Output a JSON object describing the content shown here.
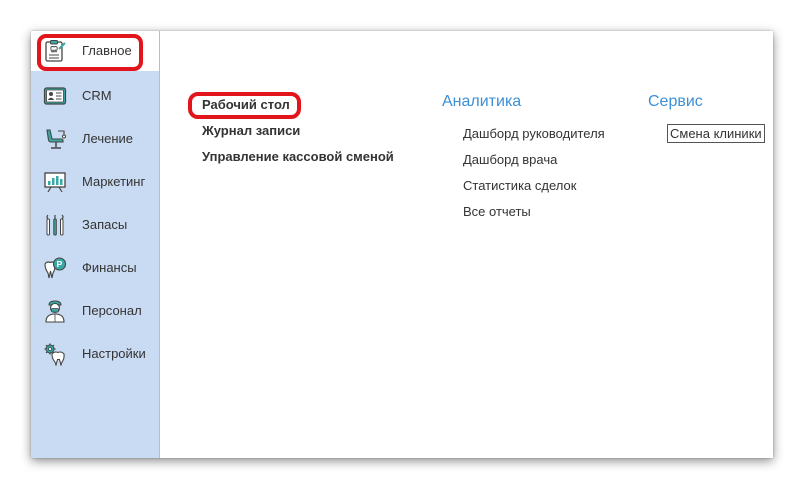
{
  "sidebar": {
    "items": [
      {
        "label": "Главное",
        "icon": "clipboard-tooth-icon"
      },
      {
        "label": "CRM",
        "icon": "id-card-icon"
      },
      {
        "label": "Лечение",
        "icon": "dental-chair-icon"
      },
      {
        "label": "Маркетинг",
        "icon": "presentation-board-icon"
      },
      {
        "label": "Запасы",
        "icon": "dental-tools-icon"
      },
      {
        "label": "Финансы",
        "icon": "tooth-coin-icon"
      },
      {
        "label": "Персонал",
        "icon": "doctor-icon"
      },
      {
        "label": "Настройки",
        "icon": "tooth-gear-icon"
      }
    ]
  },
  "main": {
    "links": [
      "Рабочий стол",
      "Журнал записи",
      "Управление кассовой сменой"
    ],
    "analytics": {
      "title": "Аналитика",
      "items": [
        "Дашборд руководителя",
        "Дашборд врача",
        "Статистика сделок",
        "Все отчеты"
      ]
    },
    "service": {
      "title": "Сервис",
      "items": [
        "Смена клиники"
      ]
    }
  },
  "colors": {
    "sidebar_bg": "#c9dbf2",
    "highlight": "#e2141c",
    "section_title": "#3d8fd6",
    "icon_teal": "#3aa8a4"
  }
}
